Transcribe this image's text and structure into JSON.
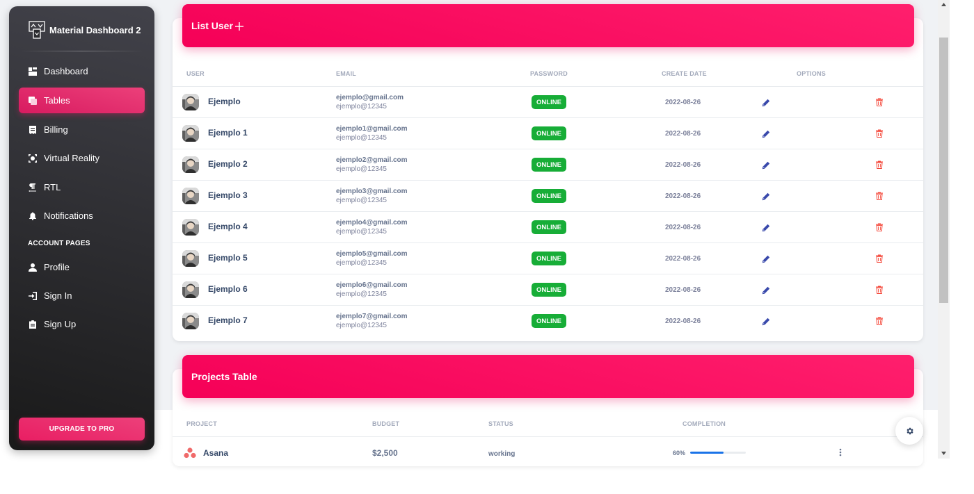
{
  "sidebar": {
    "brand": "Material Dashboard 2",
    "items": [
      {
        "label": "Dashboard",
        "icon": "dashboard-icon"
      },
      {
        "label": "Tables",
        "icon": "table-view-icon",
        "active": true
      },
      {
        "label": "Billing",
        "icon": "receipt-icon"
      },
      {
        "label": "Virtual Reality",
        "icon": "view-in-ar-icon"
      },
      {
        "label": "RTL",
        "icon": "format-textdirection-icon"
      },
      {
        "label": "Notifications",
        "icon": "notifications-icon"
      }
    ],
    "section_title": "ACCOUNT PAGES",
    "account_items": [
      {
        "label": "Profile",
        "icon": "person-icon"
      },
      {
        "label": "Sign In",
        "icon": "login-icon"
      },
      {
        "label": "Sign Up",
        "icon": "assignment-icon"
      }
    ],
    "upgrade_label": "UPGRADE TO PRO"
  },
  "users_table": {
    "title": "List User",
    "add_icon": "plus-icon",
    "columns": [
      "USER",
      "EMAIL",
      "PASSWORD",
      "CREATE DATE",
      "OPTIONS"
    ],
    "rows": [
      {
        "name": "Ejemplo",
        "email": "ejemplo@gmail.com",
        "password": "ejemplo@12345",
        "status": "ONLINE",
        "date": "2022-08-26"
      },
      {
        "name": "Ejemplo 1",
        "email": "ejemplo1@gmail.com",
        "password": "ejemplo@12345",
        "status": "ONLINE",
        "date": "2022-08-26"
      },
      {
        "name": "Ejemplo 2",
        "email": "ejemplo2@gmail.com",
        "password": "ejemplo@12345",
        "status": "ONLINE",
        "date": "2022-08-26"
      },
      {
        "name": "Ejemplo 3",
        "email": "ejemplo3@gmail.com",
        "password": "ejemplo@12345",
        "status": "ONLINE",
        "date": "2022-08-26"
      },
      {
        "name": "Ejemplo 4",
        "email": "ejemplo4@gmail.com",
        "password": "ejemplo@12345",
        "status": "ONLINE",
        "date": "2022-08-26"
      },
      {
        "name": "Ejemplo 5",
        "email": "ejemplo5@gmail.com",
        "password": "ejemplo@12345",
        "status": "ONLINE",
        "date": "2022-08-26"
      },
      {
        "name": "Ejemplo 6",
        "email": "ejemplo6@gmail.com",
        "password": "ejemplo@12345",
        "status": "ONLINE",
        "date": "2022-08-26"
      },
      {
        "name": "Ejemplo 7",
        "email": "ejemplo7@gmail.com",
        "password": "ejemplo@12345",
        "status": "ONLINE",
        "date": "2022-08-26"
      }
    ]
  },
  "projects_table": {
    "title": "Projects Table",
    "columns": [
      "PROJECT",
      "BUDGET",
      "STATUS",
      "COMPLETION"
    ],
    "rows": [
      {
        "name": "Asana",
        "budget": "$2,500",
        "status": "working",
        "completion_label": "60%",
        "completion": 0.6,
        "icon": "asana-logo-icon"
      }
    ]
  },
  "colors": {
    "accent": "#e91e63",
    "online_badge": "#17ad37",
    "edit_icon": "#3949ab",
    "delete_icon": "#f44335",
    "progress": "#1a73e8"
  }
}
